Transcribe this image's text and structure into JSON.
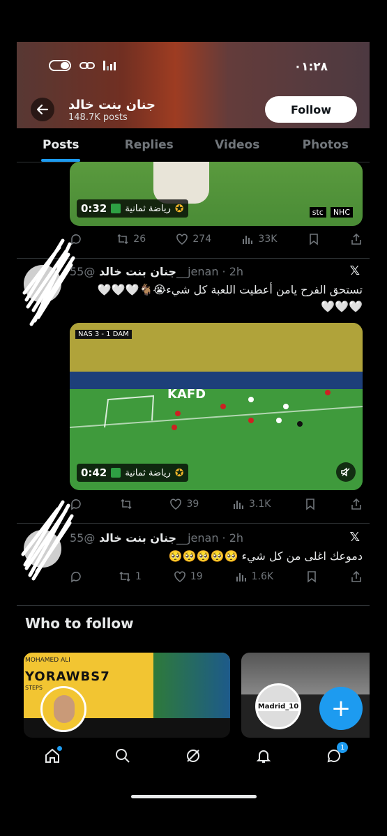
{
  "status_bar": {
    "time": "٠١:٢٨"
  },
  "profile": {
    "name": "جنان بنت خالد",
    "posts_count": "148.7K posts",
    "follow_label": "Follow"
  },
  "tabs": [
    {
      "label": "Posts"
    },
    {
      "label": "Replies"
    },
    {
      "label": "Videos"
    },
    {
      "label": "Photos"
    }
  ],
  "post0": {
    "video_duration": "0:32",
    "channel_name": "رياضة ثمانية",
    "broadcaster_logos": [
      "stc",
      "NHC"
    ],
    "stats": {
      "replies": "",
      "reposts": "26",
      "likes": "274",
      "views": "33K"
    }
  },
  "post1": {
    "display_name": "جنان بنت خالد",
    "handle": "@55__jenan · 2h",
    "text_line1": "تستحق الفرح يامن أعطيت اللعبة كل شيء😭🐐🤍🤍🤍",
    "text_line2": "🤍🤍🤍",
    "scoreboard": "NAS 3 - 1 DAM",
    "pitch_board": "KAFD",
    "video_duration": "0:42",
    "channel_name": "رياضة ثمانية",
    "stats": {
      "replies": "",
      "reposts": "",
      "likes": "39",
      "views": "3.1K"
    }
  },
  "post2": {
    "display_name": "جنان بنت خالد",
    "handle": "@55__jenan · 2h",
    "text": "دموعك اغلى من كل شيء 🥺🥺🥺🥺🥺",
    "stats": {
      "replies": "",
      "reposts": "1",
      "likes": "19",
      "views": "1.6K"
    }
  },
  "who_to_follow": {
    "title": "Who to follow",
    "cards": [
      {
        "banner_name": "MOHAMED ALI",
        "banner_handle": "YORAWBS7",
        "banner_sub": "STEPS"
      },
      {
        "avatar_label": "Madrid_10"
      }
    ]
  },
  "bottom_nav": {
    "badge": "1"
  },
  "colors": {
    "accent": "#1d9bf0",
    "bg": "#000000",
    "muted": "#71767b"
  }
}
